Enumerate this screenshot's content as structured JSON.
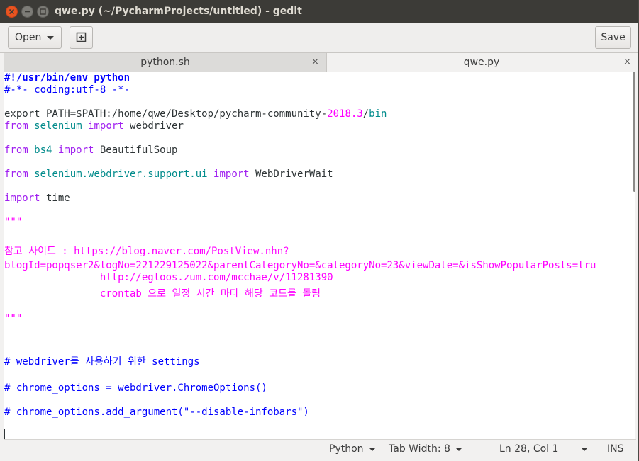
{
  "window": {
    "title": "qwe.py (~/PycharmProjects/untitled) - gedit"
  },
  "toolbar": {
    "open_label": "Open",
    "save_label": "Save"
  },
  "tabs": [
    {
      "label": "python.sh",
      "close": "×"
    },
    {
      "label": "qwe.py",
      "close": "×"
    }
  ],
  "editor": {
    "lines": {
      "l1": "#!/usr/bin/env python",
      "l2": "#-*- coding:utf-8 -*-",
      "l4a": "export PATH=$PATH:/home/qwe/Desktop/pycharm-community-",
      "l4b": "2018.3",
      "l4c": "/",
      "l4d": "bin",
      "l5a": "from",
      "l5b": "selenium",
      "l5c": "import",
      "l5d": " webdriver",
      "l7a": "from",
      "l7b": " bs4 ",
      "l7c": "import",
      "l7d": " BeautifulSoup",
      "l9a": "from",
      "l9b": "selenium.webdriver.support.ui",
      "l9c": "import",
      "l9d": " WebDriverWait",
      "l11a": "import",
      "l11b": " time",
      "l13": "\"\"\"",
      "l15": "참고 사이트 : https://blog.naver.com/PostView.nhn?",
      "l16": "blogId=popqser2&logNo=221229125022&parentCategoryNo=&categoryNo=23&viewDate=&isShowPopularPosts=tru",
      "l17": "                http://egloos.zum.com/mcchae/v/11281390",
      "l18": "                crontab 으로 일정 시간 마다 해당 코드를 돌림",
      "l20": "\"\"\"",
      "l24": "# webdriver를 사용하기 위한 settings",
      "l26": "# chrome_options = webdriver.ChromeOptions()",
      "l28": "# chrome_options.add_argument(\"--disable-infobars\")"
    }
  },
  "statusbar": {
    "language": "Python",
    "tab_width": "Tab Width: 8",
    "position": "Ln 28, Col 1",
    "mode": "INS"
  },
  "colors": {
    "accent": "#e95420",
    "keyword": "#a020f0",
    "module": "#008b8b",
    "comment": "#0000ff",
    "string": "#ff00ff"
  }
}
